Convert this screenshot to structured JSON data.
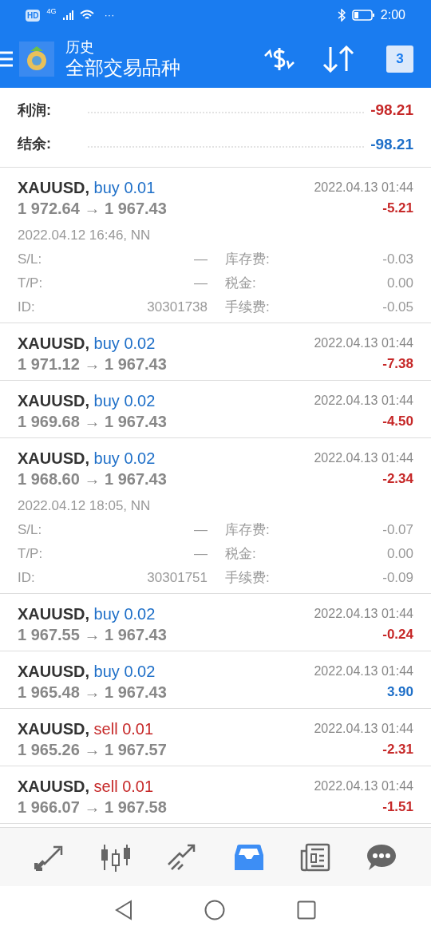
{
  "status_bar": {
    "hd": "HD",
    "network": "4G",
    "more": "···",
    "time": "2:00"
  },
  "header": {
    "title": "历史",
    "subtitle": "全部交易品种",
    "calendar_day": "3"
  },
  "summary": [
    {
      "label": "利润:",
      "value": "-98.21",
      "kind": "loss"
    },
    {
      "label": "结余:",
      "value": "-98.21",
      "kind": "neutral"
    }
  ],
  "trades": [
    {
      "symbol": "XAUUSD,",
      "side": "buy",
      "volume": "0.01",
      "prices": "1 972.64 → 1 967.43",
      "time": "2022.04.13 01:44",
      "profit": "-5.21",
      "kind": "loss",
      "expanded": true,
      "opened": "2022.04.12 16:46, NN",
      "details": [
        [
          "S/L:",
          "—",
          "库存费:",
          "-0.03"
        ],
        [
          "T/P:",
          "—",
          "税金:",
          "0.00"
        ],
        [
          "ID:",
          "30301738",
          "手续费:",
          "-0.05"
        ]
      ]
    },
    {
      "symbol": "XAUUSD,",
      "side": "buy",
      "volume": "0.02",
      "prices": "1 971.12 → 1 967.43",
      "time": "2022.04.13 01:44",
      "profit": "-7.38",
      "kind": "loss",
      "expanded": false
    },
    {
      "symbol": "XAUUSD,",
      "side": "buy",
      "volume": "0.02",
      "prices": "1 969.68 → 1 967.43",
      "time": "2022.04.13 01:44",
      "profit": "-4.50",
      "kind": "loss",
      "expanded": false
    },
    {
      "symbol": "XAUUSD,",
      "side": "buy",
      "volume": "0.02",
      "prices": "1 968.60 → 1 967.43",
      "time": "2022.04.13 01:44",
      "profit": "-2.34",
      "kind": "loss",
      "expanded": true,
      "opened": "2022.04.12 18:05, NN",
      "details": [
        [
          "S/L:",
          "—",
          "库存费:",
          "-0.07"
        ],
        [
          "T/P:",
          "—",
          "税金:",
          "0.00"
        ],
        [
          "ID:",
          "30301751",
          "手续费:",
          "-0.09"
        ]
      ]
    },
    {
      "symbol": "XAUUSD,",
      "side": "buy",
      "volume": "0.02",
      "prices": "1 967.55 → 1 967.43",
      "time": "2022.04.13 01:44",
      "profit": "-0.24",
      "kind": "loss",
      "expanded": false
    },
    {
      "symbol": "XAUUSD,",
      "side": "buy",
      "volume": "0.02",
      "prices": "1 965.48 → 1 967.43",
      "time": "2022.04.13 01:44",
      "profit": "3.90",
      "kind": "gain",
      "expanded": false
    },
    {
      "symbol": "XAUUSD,",
      "side": "sell",
      "volume": "0.01",
      "prices": "1 965.26 → 1 967.57",
      "time": "2022.04.13 01:44",
      "profit": "-2.31",
      "kind": "loss",
      "expanded": false
    },
    {
      "symbol": "XAUUSD,",
      "side": "sell",
      "volume": "0.01",
      "prices": "1 966.07 → 1 967.58",
      "time": "2022.04.13 01:44",
      "profit": "-1.51",
      "kind": "loss",
      "expanded": false
    }
  ],
  "bottom_nav": [
    {
      "kind": "quotes",
      "selected": false
    },
    {
      "kind": "chart",
      "selected": false
    },
    {
      "kind": "trade",
      "selected": false
    },
    {
      "kind": "history",
      "selected": true
    },
    {
      "kind": "news",
      "selected": false
    },
    {
      "kind": "chat",
      "selected": false
    }
  ]
}
